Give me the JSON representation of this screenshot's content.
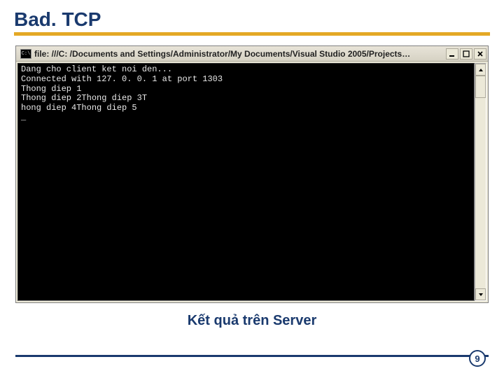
{
  "slide": {
    "title": "Bad. TCP",
    "caption": "Kết quả trên Server",
    "page_number": "9"
  },
  "console": {
    "icon_text": "C:\\",
    "title": "file: ///C: /Documents and Settings/Administrator/My Documents/Visual Studio 2005/Projects…",
    "output": "Dang cho client ket noi den...\nConnected with 127. 0. 0. 1 at port 1303\nThong diep 1\nThong diep 2Thong diep 3T\nhong diep 4Thong diep 5\n_"
  },
  "win_buttons": {
    "minimize": "minimize",
    "maximize": "maximize",
    "close": "close"
  }
}
